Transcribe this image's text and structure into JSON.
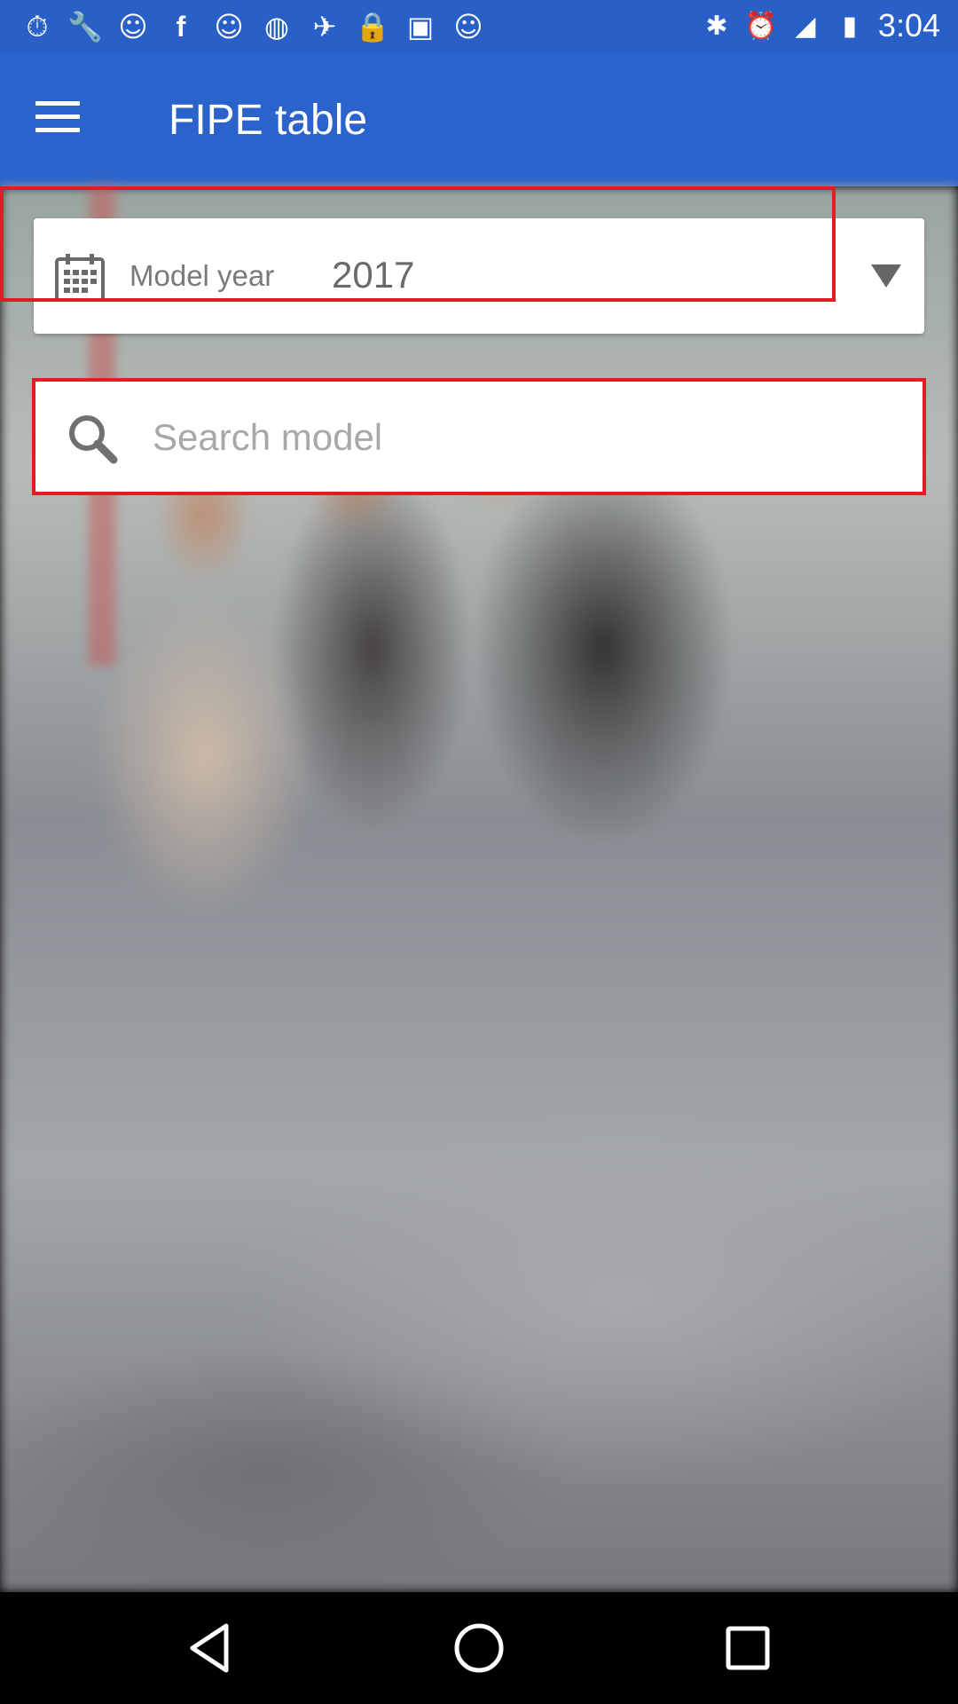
{
  "status_bar": {
    "left_icons": [
      "stopwatch-icon",
      "wrench-icon",
      "smiley-icon",
      "facebook-icon",
      "smiley-icon",
      "sync-icon",
      "fake-gps-icon",
      "lock-icon",
      "robot-icon",
      "smiley-icon"
    ],
    "right_icons": [
      "bluetooth-icon",
      "alarm-icon",
      "signal-icon",
      "battery-icon"
    ],
    "time": "3:04"
  },
  "app_bar": {
    "title": "FIPE table",
    "background": "#2b63cc"
  },
  "model_year": {
    "label": "Model year",
    "value": "2017"
  },
  "search": {
    "placeholder": "Search model",
    "value": ""
  },
  "highlight_color": "#e31b23",
  "nav_bar": {
    "buttons": [
      "back",
      "home",
      "recent-apps"
    ]
  }
}
